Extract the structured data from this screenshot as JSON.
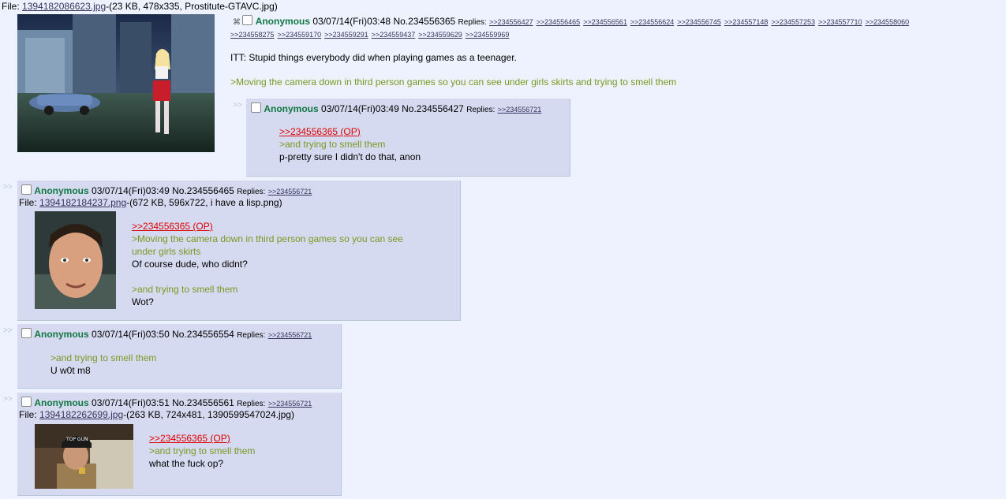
{
  "op": {
    "file_prefix": "File: ",
    "file_name": "1394182086623.jpg",
    "file_meta": "-(23 KB, 478x335, Prostitute-GTAVC.jpg)",
    "name": "Anonymous",
    "datetime": "03/07/14(Fri)03:48",
    "number": "No.234556365",
    "replies_label": "Replies:",
    "replies_row1": [
      ">>234556427",
      ">>234556465",
      ">>234556561",
      ">>234556624",
      ">>234556745",
      ">>234557148",
      ">>234557253",
      ">>234557710",
      ">>234558060"
    ],
    "replies_row2": [
      ">>234558275",
      ">>234559170",
      ">>234559291",
      ">>234559437",
      ">>234559629",
      ">>234559969"
    ],
    "subject_line": "ITT: Stupid things everybody did when playing games as a teenager.",
    "greentext": ">Moving the camera down in third person games so you can see under girls skirts and trying to smell them"
  },
  "posts": [
    {
      "name": "Anonymous",
      "datetime": "03/07/14(Fri)03:49",
      "number": "No.234556427",
      "replies_label": "Replies:",
      "reply": ">>234556721",
      "quotelink": ">>234556365 (OP)",
      "green": ">and trying to smell them",
      "text": "p-pretty sure I didn't do that, anon"
    },
    {
      "name": "Anonymous",
      "datetime": "03/07/14(Fri)03:49",
      "number": "No.234556465",
      "replies_label": "Replies:",
      "reply": ">>234556721",
      "file_prefix": "File: ",
      "file_name": "1394182184237.png",
      "file_meta": "-(672 KB, 596x722, i have a lisp.png)",
      "quotelink": ">>234556365 (OP)",
      "green1a": ">Moving the camera down in third person games so you can see",
      "green1b": "under girls skirts",
      "text1": "Of course dude, who didnt?",
      "green2": ">and trying to smell them",
      "text2": "Wot?"
    },
    {
      "name": "Anonymous",
      "datetime": "03/07/14(Fri)03:50",
      "number": "No.234556554",
      "replies_label": "Replies:",
      "reply": ">>234556721",
      "green": ">and trying to smell them",
      "text": "U w0t m8"
    },
    {
      "name": "Anonymous",
      "datetime": "03/07/14(Fri)03:51",
      "number": "No.234556561",
      "replies_label": "Replies:",
      "reply": ">>234556721",
      "file_prefix": "File: ",
      "file_name": "1394182262699.jpg",
      "file_meta": "-(263 KB, 724x481, 1390599547024.jpg)",
      "quotelink": ">>234556365 (OP)",
      "green": ">and trying to smell them",
      "text": "what the fuck op?",
      "hat_text": "TOP GUN"
    }
  ],
  "side_arrows": ">>",
  "colors": {
    "background": "#eef2ff",
    "post_bg": "#d6daf0",
    "name": "#117743",
    "greentext": "#789922",
    "quotelink": "#dd0000",
    "link": "#34345c"
  }
}
